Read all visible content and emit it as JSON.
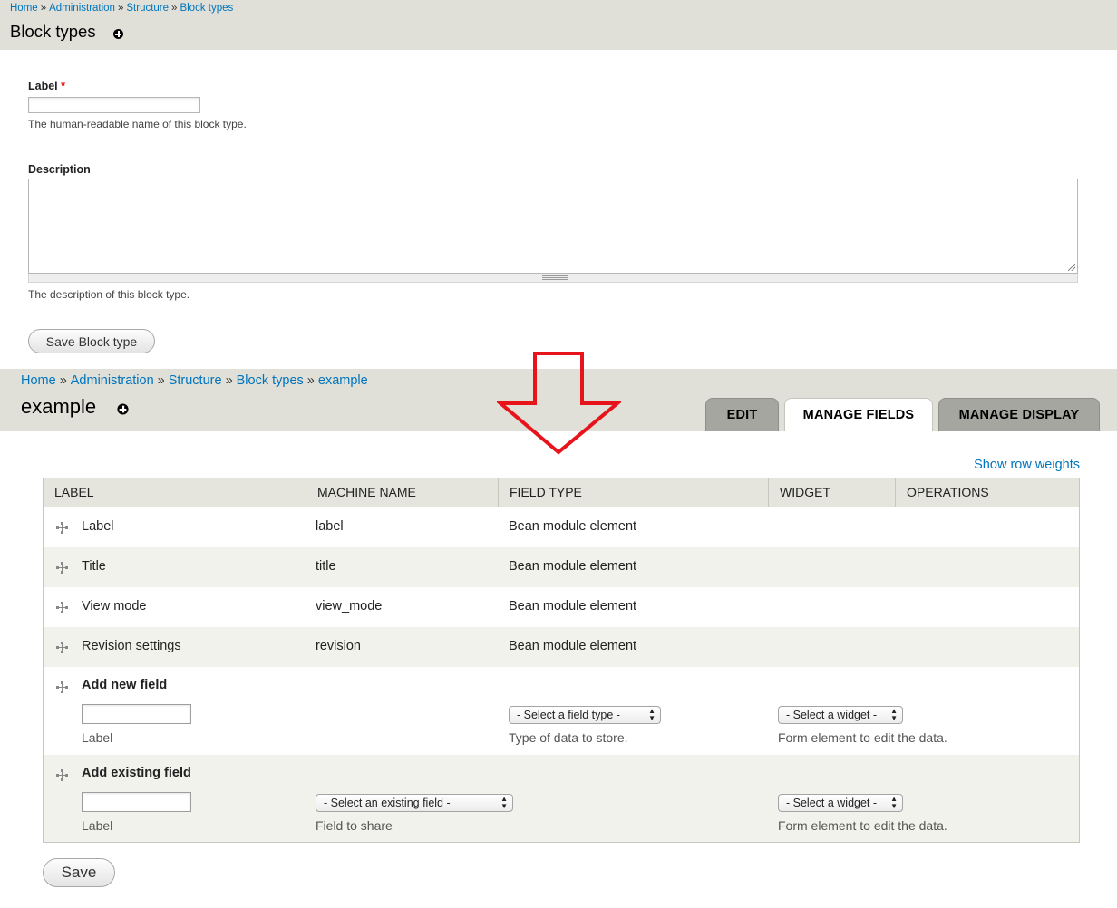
{
  "top": {
    "breadcrumb": [
      "Home",
      "Administration",
      "Structure",
      "Block types"
    ],
    "breadcrumb_separator": "»",
    "title": "Block types",
    "label_field": {
      "label": "Label",
      "required_mark": "*",
      "value": "",
      "help": "The human-readable name of this block type."
    },
    "description_field": {
      "label": "Description",
      "value": "",
      "help": "The description of this block type."
    },
    "save_button": "Save Block type"
  },
  "bottom": {
    "breadcrumb": [
      "Home",
      "Administration",
      "Structure",
      "Block types",
      "example"
    ],
    "breadcrumb_separator": "»",
    "title": "example",
    "tabs": [
      {
        "label": "EDIT",
        "active": false
      },
      {
        "label": "MANAGE FIELDS",
        "active": true
      },
      {
        "label": "MANAGE DISPLAY",
        "active": false
      }
    ],
    "show_row_weights": "Show row weights",
    "table": {
      "headers": [
        "LABEL",
        "MACHINE NAME",
        "FIELD TYPE",
        "WIDGET",
        "OPERATIONS"
      ],
      "rows": [
        {
          "label": "Label",
          "machine_name": "label",
          "field_type": "Bean module element"
        },
        {
          "label": "Title",
          "machine_name": "title",
          "field_type": "Bean module element"
        },
        {
          "label": "View mode",
          "machine_name": "view_mode",
          "field_type": "Bean module element"
        },
        {
          "label": "Revision settings",
          "machine_name": "revision",
          "field_type": "Bean module element"
        }
      ],
      "add_new_field": {
        "title": "Add new field",
        "label_value": "",
        "label_caption": "Label",
        "field_type_select": "- Select a field type -",
        "field_type_caption": "Type of data to store.",
        "widget_select": "- Select a widget -",
        "widget_caption": "Form element to edit the data."
      },
      "add_existing_field": {
        "title": "Add existing field",
        "label_value": "",
        "label_caption": "Label",
        "field_select": "- Select an existing field -",
        "field_caption": "Field to share",
        "widget_select": "- Select a widget -",
        "widget_caption": "Form element to edit the data."
      }
    },
    "save_button": "Save"
  },
  "colors": {
    "header_bg": "#e0e0d8",
    "link": "#0074bd",
    "arrow": "#e8141b",
    "required": "#ee0000",
    "tab_dark": "#a6a6a0"
  }
}
